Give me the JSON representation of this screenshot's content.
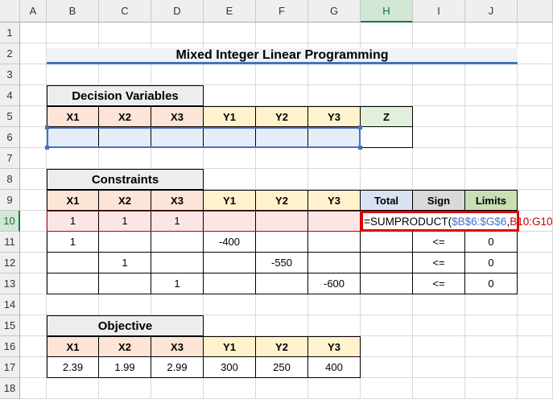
{
  "columns": [
    "A",
    "B",
    "C",
    "D",
    "E",
    "F",
    "G",
    "H",
    "I",
    "J",
    ""
  ],
  "rows": [
    "1",
    "2",
    "3",
    "4",
    "5",
    "6",
    "7",
    "8",
    "9",
    "10",
    "11",
    "12",
    "13",
    "14",
    "15",
    "16",
    "17",
    "18"
  ],
  "title": "Mixed Integer Linear Programming",
  "decision": {
    "heading": "Decision Variables",
    "headers": [
      "X1",
      "X2",
      "X3",
      "Y1",
      "Y2",
      "Y3",
      "Z"
    ]
  },
  "constraints": {
    "heading": "Constraints",
    "headers": [
      "X1",
      "X2",
      "X3",
      "Y1",
      "Y2",
      "Y3",
      "Total",
      "Sign",
      "Limits"
    ],
    "rows": [
      [
        "1",
        "1",
        "1",
        "",
        "",
        "",
        "",
        "",
        ""
      ],
      [
        "1",
        "",
        "",
        "-400",
        "",
        "",
        "",
        "<=",
        "0"
      ],
      [
        "",
        "1",
        "",
        "",
        "-550",
        "",
        "",
        "<=",
        "0"
      ],
      [
        "",
        "",
        "1",
        "",
        "",
        "-600",
        "",
        "<=",
        "0"
      ]
    ],
    "formula": {
      "prefix": "=SUMPRODUCT(",
      "ref1": "$B$6:$G$6",
      "sep": ",",
      "ref2": "B10:G10",
      "suffix": ")"
    }
  },
  "objective": {
    "heading": "Objective",
    "headers": [
      "X1",
      "X2",
      "X3",
      "Y1",
      "Y2",
      "Y3"
    ],
    "values": [
      "2.39",
      "1.99",
      "2.99",
      "300",
      "250",
      "400"
    ]
  },
  "colors": {
    "ref1": "#4472c4",
    "ref2": "#c00000",
    "highlight": "#e00000"
  }
}
